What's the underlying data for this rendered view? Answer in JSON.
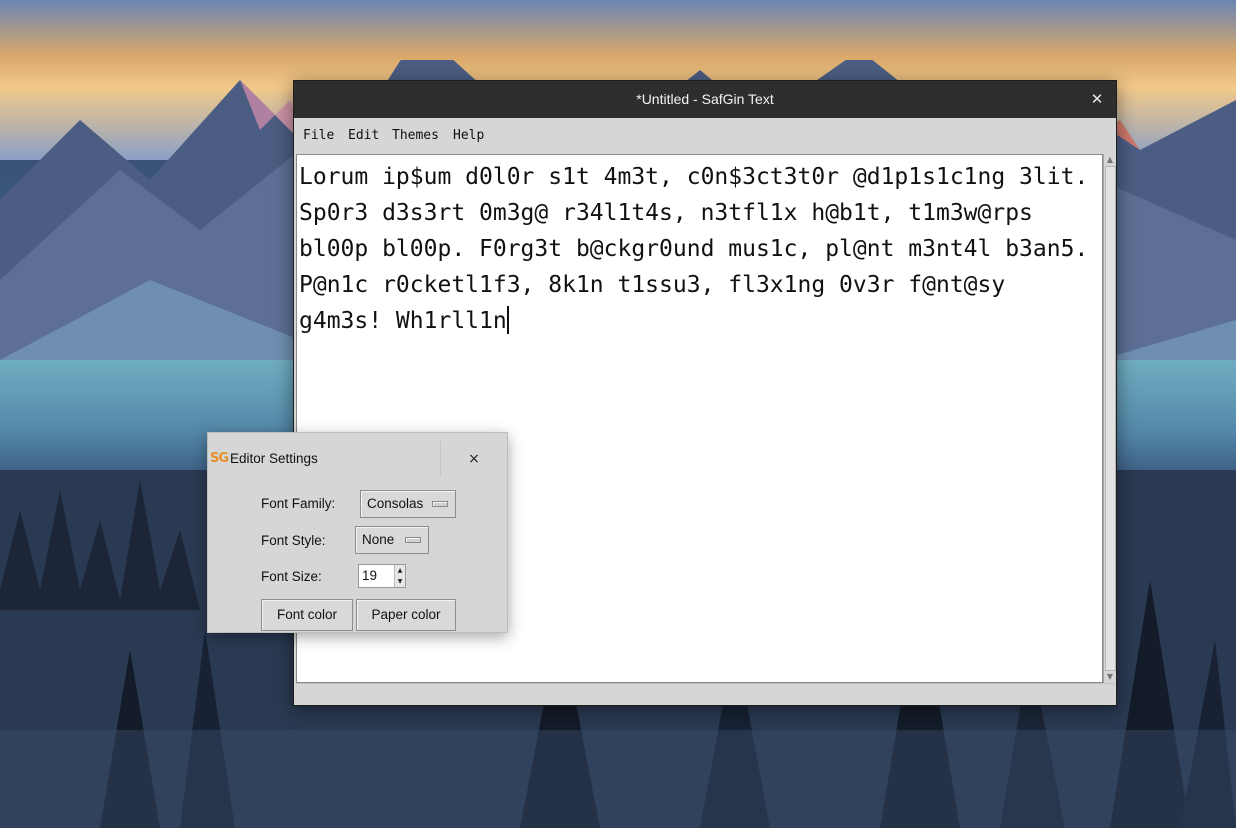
{
  "window": {
    "title": "*Untitled - SafGin Text",
    "close_glyph": "✕"
  },
  "menu": [
    {
      "label": "File"
    },
    {
      "label": "Edit"
    },
    {
      "label": "Themes"
    },
    {
      "label": "Help"
    }
  ],
  "editor": {
    "content": "Lorum ip$um d0l0r s1t 4m3t, c0n$3ct3t0r @d1p1s1c1ng 3lit. Sp0r3 d3s3rt 0m3g@ r34l1t4s, n3tfl1x h@b1t, t1m3w@rps bl00p bl00p. F0rg3t b@ckgr0und mus1c, pl@nt m3nt4l b3an5. P@n1c r0cketl1f3, 8k1n t1ssu3, fl3x1ng 0v3r f@nt@sy g4m3s! Wh1rll1n"
  },
  "settings_dialog": {
    "logo": "SG",
    "title": "Editor Settings",
    "close_glyph": "×",
    "font_family_label": "Font Family:",
    "font_family_value": "Consolas",
    "font_style_label": "Font Style:",
    "font_style_value": "None",
    "font_size_label": "Font Size:",
    "font_size_value": "19",
    "font_color_button": "Font color",
    "paper_color_button": "Paper color"
  }
}
